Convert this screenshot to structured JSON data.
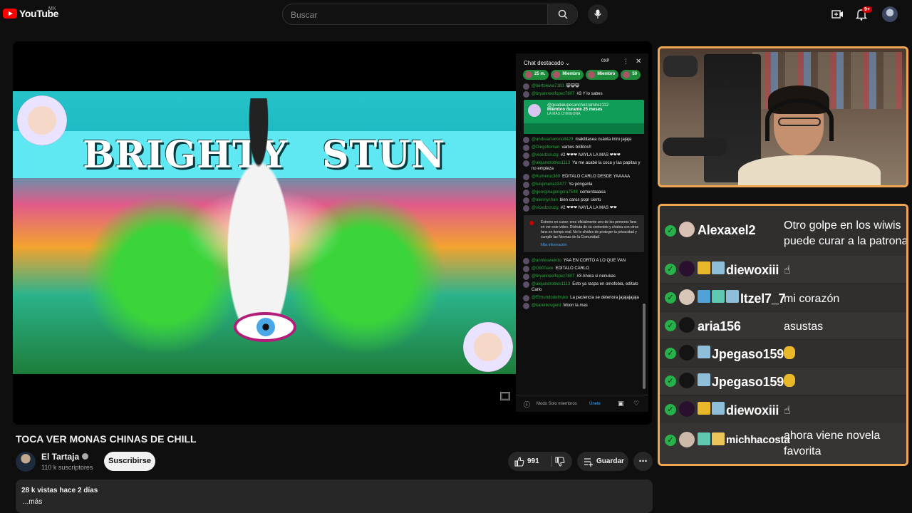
{
  "header": {
    "logo_text": "YouTube",
    "region": "MX",
    "search_placeholder": "Buscar",
    "notification_count": "9+"
  },
  "video": {
    "banner_left": "BRIGHTY",
    "banner_right": "STUN",
    "title": "TOCA VER MONAS CHINAS DE CHILL"
  },
  "chat": {
    "title": "Chat destacado",
    "xp_label": "0XP",
    "tickers": [
      "25 m.",
      "Miembro",
      "Miembro",
      "50"
    ],
    "messages_before": [
      {
        "author": "@bertolewa7183",
        "text": "😸😸😸"
      },
      {
        "author": "@bryanneelfopez7807",
        "text": "#3 Y lo sabes"
      }
    ],
    "member_card": {
      "author": "@guadalupesanchezramirez112",
      "title": "Miembro durante 25 meses",
      "subtitle": "LA MÁS CHINGONA"
    },
    "messages_middle": [
      {
        "author": "@andreamoreno8429",
        "text": "makilitasea cuánta intro jajaja"
      },
      {
        "author": "@Diegolloman",
        "text": "vamos brillitos!!"
      },
      {
        "author": "@vicedzcruzg",
        "text": "#2 ❤❤❤ NAYLA LA MAS ❤❤❤"
      },
      {
        "author": "@alejandrobles1113",
        "text": "Ya me acabé la coca y las papitas y no empieza"
      },
      {
        "author": "@Kumeruc369",
        "text": "EDITALO CARLO DESDE YAAAAA"
      },
      {
        "author": "@luisjimenez3477",
        "text": "Ya pónganla"
      },
      {
        "author": "@georginagongora7548",
        "text": "comentaaasa"
      },
      {
        "author": "@alennychan",
        "text": "bien caros popr cierto"
      },
      {
        "author": "@vicedzcruzg",
        "text": "#2 ❤❤❤ NAYLA LA MAS ❤❤"
      }
    ],
    "notice": {
      "text": "Estreno en curso: eres oficialmente uno de los primeros fans en ver este video. Disfruta de su contenido y chatea con otros fans en tiempo real. No te olvides de proteger tu privacidad y cumplir las Normas de la Comunidad.",
      "link": "Más información"
    },
    "messages_after": [
      {
        "author": "@anntesweirdo",
        "text": "YAA EN CORTO A LO QUE VAN"
      },
      {
        "author": "@G800axe",
        "text": "EDITALO CARLO"
      },
      {
        "author": "@bryanneelfopez7807",
        "text": "#3 Ahora si nenukas"
      },
      {
        "author": "@alejandrobles1113",
        "text": "Esto ya raspa en omofobia, editalo Carlo"
      },
      {
        "author": "@Elmundodeltruko",
        "text": "La paciencia se deteriora jajajajajaja"
      },
      {
        "author": "@karenkrugerd",
        "text": "Moon la mas"
      }
    ],
    "footer_text": "Modo Solo miembros",
    "footer_join": "Únete"
  },
  "channel": {
    "name": "El Tartaja",
    "subscribers": "110 k suscriptores",
    "subscribe_label": "Suscribirse"
  },
  "actions": {
    "likes": "991",
    "save_label": "Guardar"
  },
  "description": {
    "meta": "28 k vistas  hace 2 días",
    "more": "...más"
  },
  "overlay_chat": {
    "rows": [
      {
        "name": "Alexaxel2",
        "message": "Otro golpe en los wiwis",
        "message2": "puede curar a la patrona"
      },
      {
        "name": "diewoxiii",
        "message": "☝"
      },
      {
        "name": "Itzel7_7",
        "message": "mi corazón"
      },
      {
        "name": "aria156",
        "message": "asustas"
      },
      {
        "name": "Jpegaso159",
        "message": ""
      },
      {
        "name": "Jpegaso159",
        "message": ""
      },
      {
        "name": "diewoxiii",
        "message": "☝"
      },
      {
        "name": "michhacosta",
        "message": "ahora viene novela",
        "message2": "favorita"
      }
    ]
  },
  "colors": {
    "accent_green": "#2ba640",
    "member_green": "#0f9d58",
    "youtube_red": "#ff0000",
    "overlay_border": "#f0a650"
  },
  "icons": [
    "youtube-logo-icon",
    "search-icon",
    "mic-icon",
    "create-video-icon",
    "bell-icon",
    "like-icon",
    "dislike-icon",
    "save-icon",
    "more-icon",
    "close-icon",
    "heart-icon",
    "chevron-down-icon",
    "check-icon"
  ]
}
